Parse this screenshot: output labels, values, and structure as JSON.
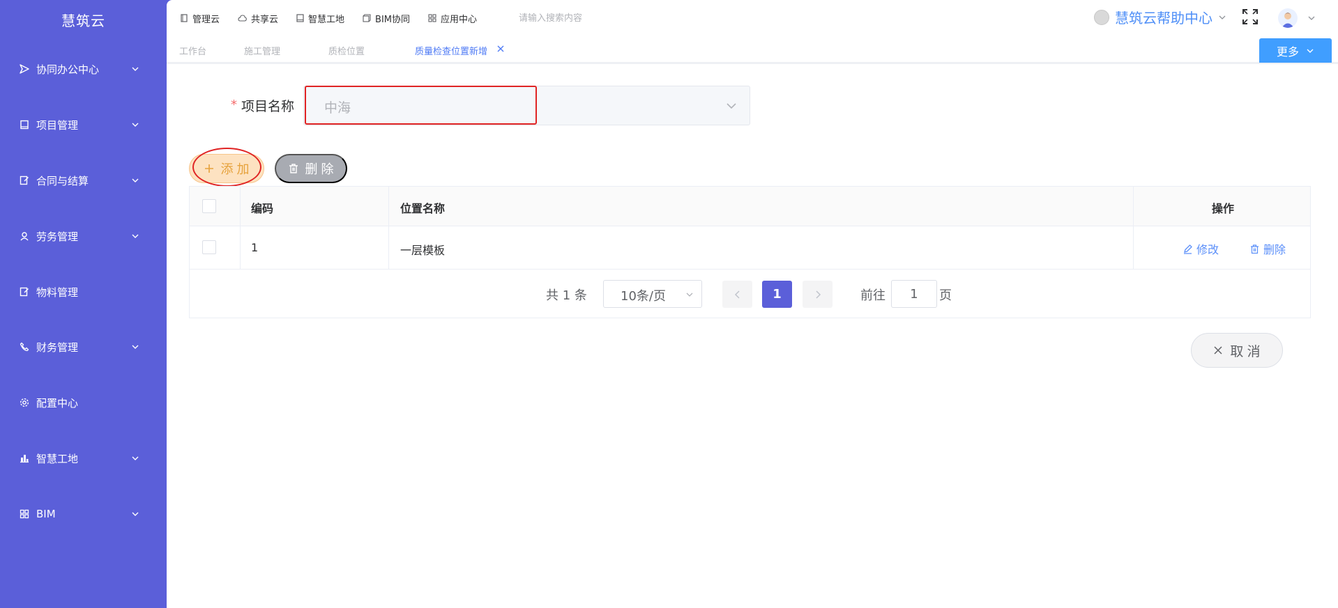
{
  "brand": "慧筑云",
  "sidebar": {
    "items": [
      {
        "label": "协同办公中心",
        "icon": "send-icon",
        "has_submenu": true
      },
      {
        "label": "项目管理",
        "icon": "book-icon",
        "has_submenu": true
      },
      {
        "label": "合同与结算",
        "icon": "edit-doc-icon",
        "has_submenu": true
      },
      {
        "label": "劳务管理",
        "icon": "worker-icon",
        "has_submenu": true
      },
      {
        "label": "物料管理",
        "icon": "edit-doc-icon",
        "has_submenu": false
      },
      {
        "label": "财务管理",
        "icon": "phone-icon",
        "has_submenu": true
      },
      {
        "label": "配置中心",
        "icon": "gear-icon",
        "has_submenu": false
      },
      {
        "label": "智慧工地",
        "icon": "building-icon",
        "has_submenu": true
      },
      {
        "label": "BIM",
        "icon": "grid-icon",
        "has_submenu": true
      }
    ]
  },
  "topnav": [
    {
      "label": "管理云",
      "icon": "doc-icon"
    },
    {
      "label": "共享云",
      "icon": "cloud-icon"
    },
    {
      "label": "智慧工地",
      "icon": "book-icon"
    },
    {
      "label": "BIM协同",
      "icon": "cube-icon"
    },
    {
      "label": "应用中心",
      "icon": "grid-icon"
    }
  ],
  "search": {
    "placeholder": "请输入搜索内容"
  },
  "help": {
    "label": "慧筑云帮助中心"
  },
  "tabs": [
    {
      "label": "工作台",
      "active": false
    },
    {
      "label": "施工管理",
      "active": false
    },
    {
      "label": "质检位置",
      "active": false
    },
    {
      "label": "质量检查位置新增",
      "active": true
    }
  ],
  "more_button": "更多",
  "form": {
    "required_mark": "*",
    "project_label": "项目名称",
    "project_value": "中海"
  },
  "toolbar": {
    "add_label": "添 加",
    "delete_label": "删 除"
  },
  "table": {
    "columns": [
      "编码",
      "位置名称",
      "操作"
    ],
    "rows": [
      {
        "code": "1",
        "name": "一层模板",
        "actions": [
          "修改",
          "删除"
        ]
      }
    ]
  },
  "pagination": {
    "total_text": "共 1 条",
    "page_size": "10条/页",
    "current_page": "1",
    "goto_prefix": "前往",
    "goto_value": "1",
    "goto_suffix": "页"
  },
  "cancel_button": "取 消",
  "colors": {
    "sidebar_bg": "#5b5fd9",
    "accent_blue": "#409eff",
    "link_blue": "#5b8ff9",
    "add_bg": "#fde2c1",
    "add_text": "#e6a23c",
    "highlight_red": "#e02424"
  }
}
